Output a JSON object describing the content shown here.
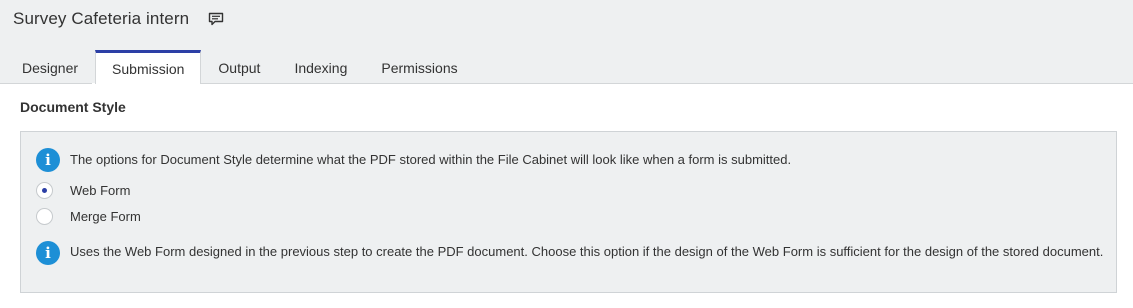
{
  "header": {
    "title": "Survey Cafeteria intern",
    "comment_icon": "comment-icon"
  },
  "tabs": [
    {
      "label": "Designer",
      "active": false
    },
    {
      "label": "Submission",
      "active": true
    },
    {
      "label": "Output",
      "active": false
    },
    {
      "label": "Indexing",
      "active": false
    },
    {
      "label": "Permissions",
      "active": false
    }
  ],
  "section": {
    "heading": "Document Style",
    "info_top": "The options for Document Style determine what the PDF stored within the File Cabinet will look like when a form is submitted.",
    "options": [
      {
        "label": "Web Form",
        "selected": true
      },
      {
        "label": "Merge Form",
        "selected": false
      }
    ],
    "info_bottom": "Uses the Web Form designed in the previous step to create the PDF document. Choose this option if the design of the Web Form is sufficient for the design of the stored document."
  },
  "colors": {
    "accent": "#2c3fa6",
    "info_icon": "#1d8fd6",
    "panel_bg": "#eef0f1"
  }
}
